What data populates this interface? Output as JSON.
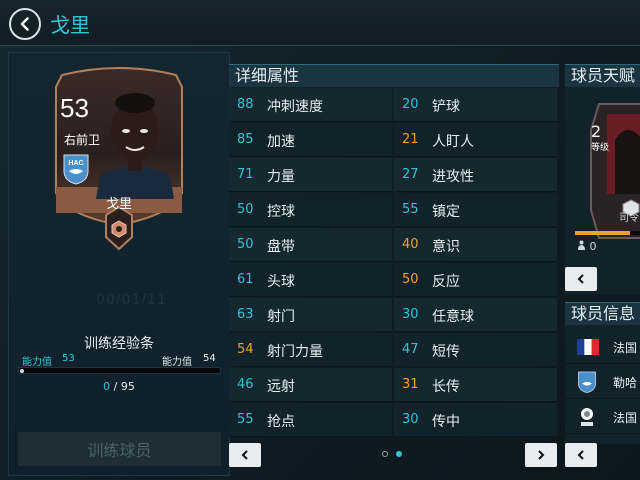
{
  "header": {
    "title": "戈里"
  },
  "player_card": {
    "rating": "53",
    "position": "右前卫",
    "name": "戈里",
    "club": "HAC"
  },
  "faded_text": "00/01/11",
  "training": {
    "title": "训练经验条",
    "from_label": "能力值",
    "from_value": "53",
    "to_label": "能力值",
    "to_value": "54",
    "current": "0",
    "separator": "/",
    "total": "95",
    "progress": 0,
    "button_label": "训练球员"
  },
  "attributes": {
    "title": "详细属性",
    "left": [
      {
        "value": "88",
        "label": "冲刺速度",
        "color": "#30c6d6"
      },
      {
        "value": "85",
        "label": "加速",
        "color": "#30c6d6"
      },
      {
        "value": "71",
        "label": "力量",
        "color": "#30c6d6"
      },
      {
        "value": "50",
        "label": "控球",
        "color": "#30c6d6"
      },
      {
        "value": "50",
        "label": "盘带",
        "color": "#30c6d6"
      },
      {
        "value": "61",
        "label": "头球",
        "color": "#30c6d6"
      },
      {
        "value": "63",
        "label": "射门",
        "color": "#30c6d6"
      },
      {
        "value": "54",
        "label": "射门力量",
        "color": "#f0a030"
      },
      {
        "value": "46",
        "label": "远射",
        "color": "#30c6d6"
      },
      {
        "value": "55",
        "label": "抢点",
        "color": "#30c6d6"
      }
    ],
    "right": [
      {
        "value": "20",
        "label": "铲球",
        "color": "#30c6d6"
      },
      {
        "value": "21",
        "label": "人盯人",
        "color": "#f0a030"
      },
      {
        "value": "27",
        "label": "进攻性",
        "color": "#30c6d6"
      },
      {
        "value": "55",
        "label": "镇定",
        "color": "#30c6d6"
      },
      {
        "value": "40",
        "label": "意识",
        "color": "#f0a030"
      },
      {
        "value": "50",
        "label": "反应",
        "color": "#f0a030"
      },
      {
        "value": "30",
        "label": "任意球",
        "color": "#30c6d6"
      },
      {
        "value": "47",
        "label": "短传",
        "color": "#30c6d6"
      },
      {
        "value": "31",
        "label": "长传",
        "color": "#f0a030"
      },
      {
        "value": "30",
        "label": "传中",
        "color": "#30c6d6"
      }
    ],
    "page_current": 2,
    "page_total": 2
  },
  "traits": {
    "title": "球员天赋",
    "level": "2",
    "level_label": "等级",
    "subtitle": "司令",
    "person_count": "0",
    "progress": 0.85
  },
  "info": {
    "title": "球员信息",
    "rows": [
      {
        "icon": "france-flag-icon",
        "text": "法国"
      },
      {
        "icon": "hac-badge-icon",
        "text": "勒哈"
      },
      {
        "icon": "ligue2-logo-icon",
        "text": "法国"
      }
    ]
  },
  "colors": {
    "accent": "#30c6d6",
    "highlight": "#f0a030",
    "card_bronze": "#9c6a4e"
  }
}
